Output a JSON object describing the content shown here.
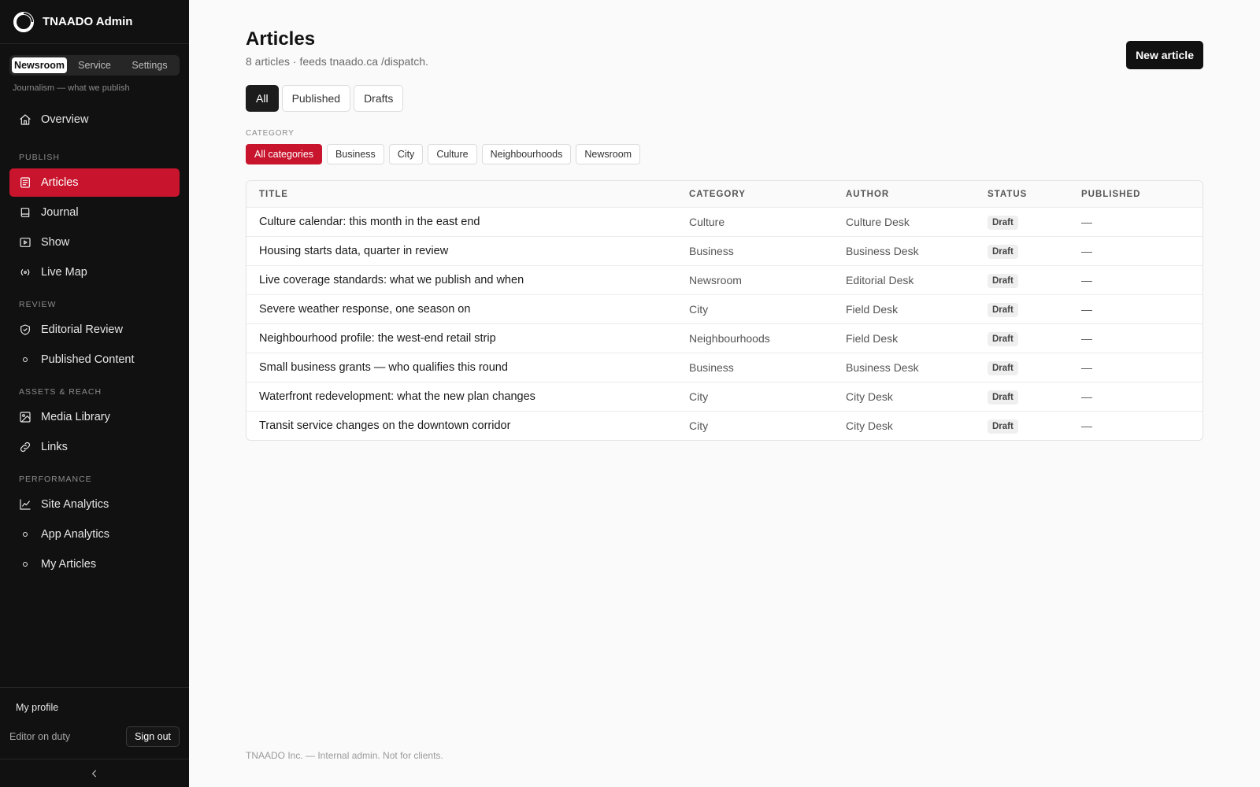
{
  "app": {
    "title": "TNAADO Admin"
  },
  "sidebar": {
    "switcher": [
      {
        "label": "Newsroom",
        "active": true
      },
      {
        "label": "Service",
        "active": false
      },
      {
        "label": "Settings",
        "active": false
      }
    ],
    "switcher_caption": "Journalism — what we publish",
    "overview": {
      "label": "Overview",
      "icon": "home-icon"
    },
    "sections": [
      {
        "title": "Publish",
        "items": [
          {
            "label": "Articles",
            "icon": "article-icon",
            "active": true
          },
          {
            "label": "Journal",
            "icon": "book-icon"
          },
          {
            "label": "Show",
            "icon": "play-icon"
          },
          {
            "label": "Live Map",
            "icon": "broadcast-icon"
          }
        ]
      },
      {
        "title": "Review",
        "items": [
          {
            "label": "Editorial Review",
            "icon": "shield-check-icon"
          },
          {
            "label": "Published Content",
            "icon": "dot-icon"
          }
        ]
      },
      {
        "title": "Assets & Reach",
        "items": [
          {
            "label": "Media Library",
            "icon": "image-icon"
          },
          {
            "label": "Links",
            "icon": "link-icon"
          }
        ]
      },
      {
        "title": "Performance",
        "items": [
          {
            "label": "Site Analytics",
            "icon": "line-chart-icon"
          },
          {
            "label": "App Analytics",
            "icon": "dot-icon"
          },
          {
            "label": "My Articles",
            "icon": "dot-icon"
          }
        ]
      }
    ],
    "footer": {
      "profile_label": "My profile",
      "role": "Editor on duty",
      "sign_out": "Sign out"
    }
  },
  "main": {
    "title": "Articles",
    "subtitle": "8 articles · feeds tnaado.ca /dispatch.",
    "new_button": "New article",
    "tabs": [
      {
        "label": "All",
        "active": true
      },
      {
        "label": "Published",
        "active": false
      },
      {
        "label": "Drafts",
        "active": false
      }
    ],
    "category_label": "CATEGORY",
    "categories": [
      {
        "label": "All categories",
        "active": true
      },
      {
        "label": "Business"
      },
      {
        "label": "City"
      },
      {
        "label": "Culture"
      },
      {
        "label": "Neighbourhoods"
      },
      {
        "label": "Newsroom"
      }
    ],
    "table": {
      "columns": [
        "TITLE",
        "CATEGORY",
        "AUTHOR",
        "STATUS",
        "PUBLISHED"
      ],
      "rows": [
        {
          "title": "Culture calendar: this month in the east end",
          "category": "Culture",
          "author": "Culture Desk",
          "status": "Draft",
          "published": "—"
        },
        {
          "title": "Housing starts data, quarter in review",
          "category": "Business",
          "author": "Business Desk",
          "status": "Draft",
          "published": "—"
        },
        {
          "title": "Live coverage standards: what we publish and when",
          "category": "Newsroom",
          "author": "Editorial Desk",
          "status": "Draft",
          "published": "—"
        },
        {
          "title": "Severe weather response, one season on",
          "category": "City",
          "author": "Field Desk",
          "status": "Draft",
          "published": "—"
        },
        {
          "title": "Neighbourhood profile: the west-end retail strip",
          "category": "Neighbourhoods",
          "author": "Field Desk",
          "status": "Draft",
          "published": "—"
        },
        {
          "title": "Small business grants — who qualifies this round",
          "category": "Business",
          "author": "Business Desk",
          "status": "Draft",
          "published": "—"
        },
        {
          "title": "Waterfront redevelopment: what the new plan changes",
          "category": "City",
          "author": "City Desk",
          "status": "Draft",
          "published": "—"
        },
        {
          "title": "Transit service changes on the downtown corridor",
          "category": "City",
          "author": "City Desk",
          "status": "Draft",
          "published": "—"
        }
      ]
    },
    "footer_note": "TNAADO Inc. — Internal admin. Not for clients."
  },
  "colors": {
    "accent": "#c8152d",
    "sidebar_bg": "#111111",
    "page_bg": "#fafafa"
  }
}
